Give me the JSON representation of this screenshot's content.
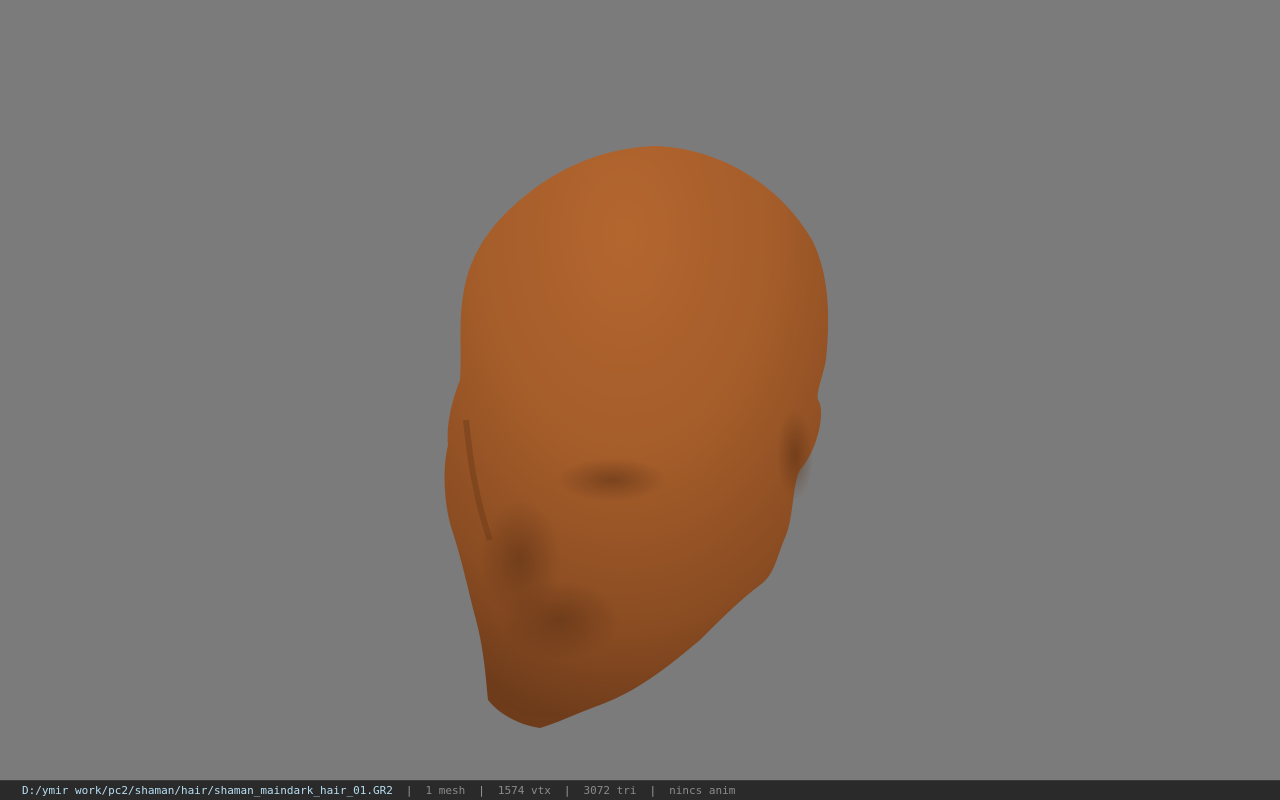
{
  "viewport": {
    "background_color": "#7b7b7b",
    "model_color": "#a8602c",
    "model": "head-mesh"
  },
  "statusbar": {
    "file_path": "D:/ymir work/pc2/shaman/hair/shaman_maindark_hair_01.GR2",
    "separator": "|",
    "mesh_count": "1 mesh",
    "vertex_count": "1574 vtx",
    "triangle_count": "3072 tri",
    "anim_status": "nincs anim"
  }
}
